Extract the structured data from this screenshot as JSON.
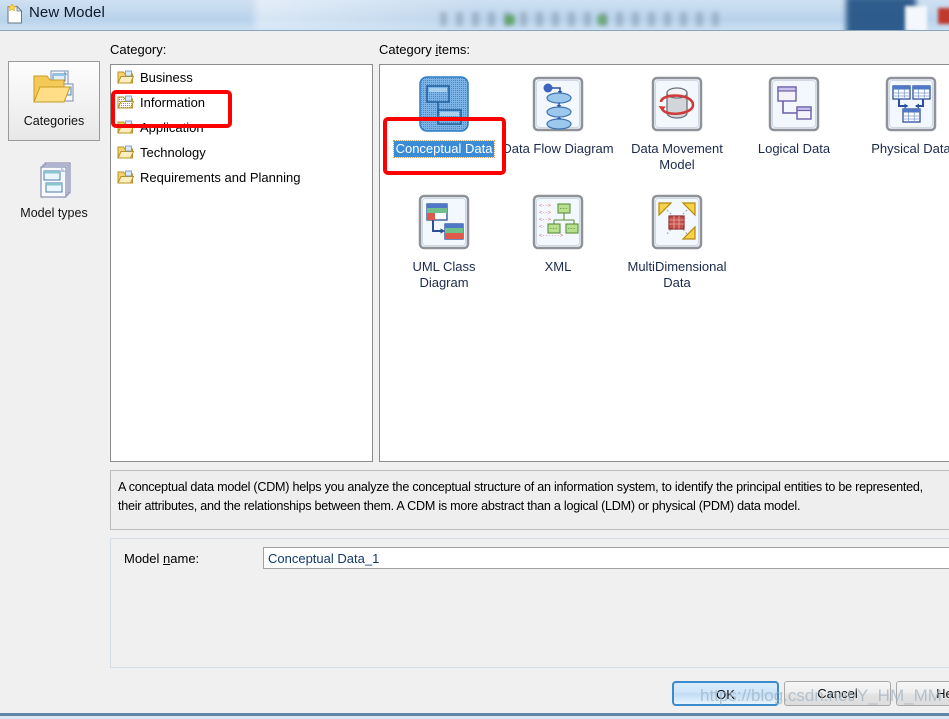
{
  "window": {
    "title": "New Model",
    "icon": "new-document-icon"
  },
  "rail": {
    "items": [
      {
        "label": "Categories",
        "icon": "folder-documents-icon",
        "selected": true
      },
      {
        "label": "Model types",
        "icon": "stacked-documents-icon",
        "selected": false
      }
    ]
  },
  "labels": {
    "category": "Category:",
    "category_accel": "g",
    "category_items": "Category items:",
    "category_items_accel": "i",
    "model_name": "Model name:",
    "model_name_accel": "n"
  },
  "category_list": {
    "items": [
      {
        "label": "Business",
        "icon": "folder-icon",
        "selected": false
      },
      {
        "label": "Information",
        "icon": "folder-open-icon",
        "selected": true
      },
      {
        "label": "Application",
        "icon": "folder-icon",
        "selected": false
      },
      {
        "label": "Technology",
        "icon": "folder-icon",
        "selected": false
      },
      {
        "label": "Requirements and Planning",
        "icon": "folder-icon",
        "selected": false
      }
    ]
  },
  "category_items": {
    "items": [
      {
        "label": "Conceptual Data",
        "icon": "conceptual-data-icon",
        "selected": true
      },
      {
        "label": "Data Flow Diagram",
        "icon": "data-flow-diagram-icon",
        "selected": false
      },
      {
        "label": "Data Movement Model",
        "icon": "data-movement-model-icon",
        "selected": false
      },
      {
        "label": "Logical Data",
        "icon": "logical-data-icon",
        "selected": false
      },
      {
        "label": "Physical Data",
        "icon": "physical-data-icon",
        "selected": false
      },
      {
        "label": "UML Class Diagram",
        "icon": "uml-class-diagram-icon",
        "selected": false
      },
      {
        "label": "XML",
        "icon": "xml-icon",
        "selected": false
      },
      {
        "label": "MultiDimensional Data",
        "icon": "multidimensional-data-icon",
        "selected": false
      }
    ]
  },
  "description": {
    "text": "A conceptual data model (CDM) helps you analyze the conceptual structure of an information system, to identify the principal entities to be represented, their attributes, and the relationships between them. A CDM is more abstract than a logical (LDM) or physical (PDM) data model."
  },
  "model_name": {
    "value": "Conceptual Data_1",
    "placeholder": ""
  },
  "footer": {
    "ok": "OK",
    "cancel": "Cancel",
    "help": "Help"
  },
  "watermark": {
    "text": "https://blog.csdn.net/Y_HM_MM"
  },
  "colors": {
    "accent": "#3a8cd8",
    "annotation": "#ff0000",
    "titlebar": "#c2d8ee",
    "dialog_bg": "#f0f0f0",
    "field_text": "#12396b"
  }
}
